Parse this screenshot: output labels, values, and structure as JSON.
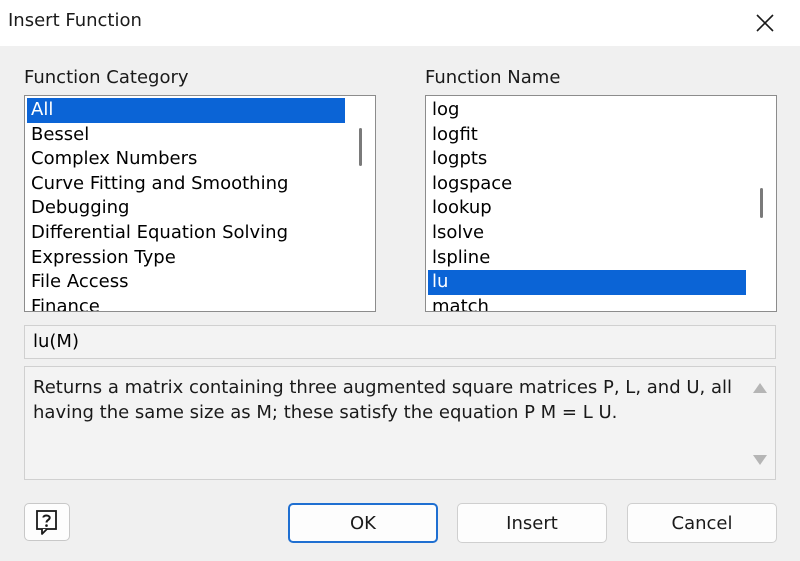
{
  "window": {
    "title": "Insert Function"
  },
  "category": {
    "label": "Function Category",
    "items": [
      {
        "label": " All",
        "selected": true
      },
      {
        "label": "Bessel"
      },
      {
        "label": "Complex Numbers"
      },
      {
        "label": "Curve Fitting and Smoothing"
      },
      {
        "label": "Debugging"
      },
      {
        "label": "Differential Equation Solving"
      },
      {
        "label": "Expression Type"
      },
      {
        "label": "File Access"
      },
      {
        "label": "Finance"
      }
    ]
  },
  "function_name": {
    "label": "Function Name",
    "items": [
      {
        "label": "log"
      },
      {
        "label": "logfit"
      },
      {
        "label": "logpts"
      },
      {
        "label": "logspace"
      },
      {
        "label": "lookup"
      },
      {
        "label": "lsolve"
      },
      {
        "label": "lspline"
      },
      {
        "label": "lu",
        "selected": true
      },
      {
        "label": "match"
      }
    ]
  },
  "signature": "lu(M)",
  "description": "Returns a matrix containing three augmented square matrices P, L, and U, all having the same size as M; these satisfy the equation P M = L U.",
  "buttons": {
    "ok": "OK",
    "insert": "Insert",
    "cancel": "Cancel"
  },
  "colors": {
    "selection": "#0b64d6",
    "default_button_border": "#1f6fd1"
  },
  "icons": {
    "close": "close-icon",
    "help": "help-icon"
  }
}
